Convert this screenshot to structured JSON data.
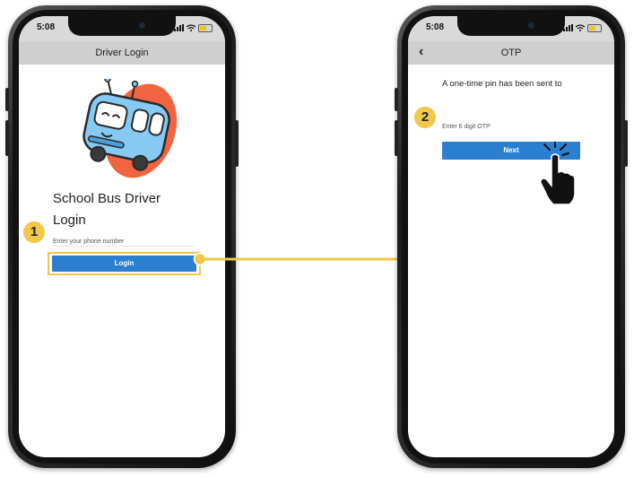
{
  "status": {
    "time": "5:08"
  },
  "screen1": {
    "title": "Driver Login",
    "heading_line1": "School Bus Driver",
    "heading_line2": "Login",
    "phone_placeholder": "Enter your phone number",
    "login_label": "Login",
    "step": "1"
  },
  "screen2": {
    "title": "OTP",
    "back": "‹",
    "message": "A one-time pin has been sent to",
    "otp_placeholder": "Enter 6 digit OTP",
    "next_label": "Next",
    "step": "2"
  },
  "colors": {
    "accent": "#2a7fd0",
    "highlight": "#f0c84b",
    "blob": "#f2643f",
    "bus": "#86c9f2"
  }
}
